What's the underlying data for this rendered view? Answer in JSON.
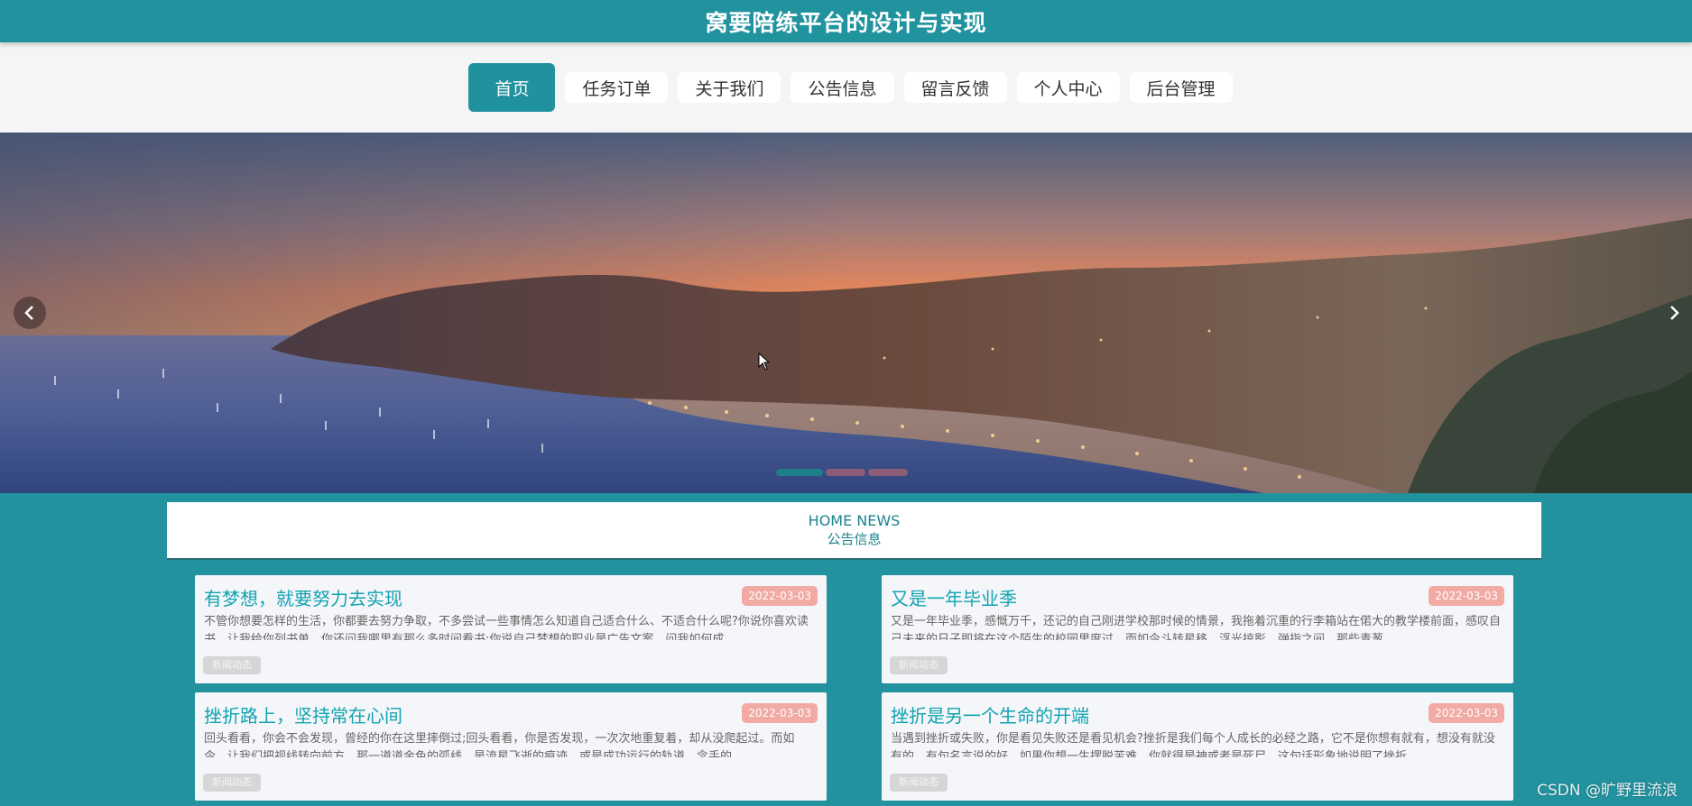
{
  "header": {
    "title": "窝要陪练平台的设计与实现"
  },
  "nav": {
    "items": [
      {
        "label": "首页",
        "active": true
      },
      {
        "label": "任务订单"
      },
      {
        "label": "关于我们"
      },
      {
        "label": "公告信息"
      },
      {
        "label": "留言反馈"
      },
      {
        "label": "个人中心"
      },
      {
        "label": "后台管理"
      }
    ]
  },
  "banner": {
    "image": "harbor-town-sunset-photo",
    "prev_icon": "chevron-left-icon",
    "next_icon": "chevron-right-icon",
    "slides_count": 3,
    "active_slide": 1
  },
  "news_section": {
    "title_en": "HOME NEWS",
    "title_zh": "公告信息"
  },
  "news": [
    {
      "title": "有梦想，就要努力去实现",
      "date": "2022-03-03",
      "excerpt": "不管你想要怎样的生活，你都要去努力争取，不多尝试一些事情怎么知道自己适合什么、不适合什么呢?你说你喜欢读书，让我给你列书单，你还问我哪里有那么多时间看书;你说自己梦想的职业是广告文案，问我如何成",
      "tag": "新闻动态"
    },
    {
      "title": "又是一年毕业季",
      "date": "2022-03-03",
      "excerpt": "又是一年毕业季，感慨万千，还记的自己刚进学校那时候的情景，我拖着沉重的行李箱站在偌大的教学楼前面，感叹自己未来的日子即将在这个陌生的校园里度过，而如今斗转星移，浮光掠影，弹指之间，那些青葱",
      "tag": "新闻动态"
    },
    {
      "title": "挫折路上，坚持常在心间",
      "date": "2022-03-03",
      "excerpt": "回头看看，你会不会发现，曾经的你在这里摔倒过;回头看看，你是否发现，一次次地重复着，却从没爬起过。而如今，让我们把视线转向前方，那一道道金色的弧线，是流星飞逝的痕迹，或是成功运行的轨道，念手的",
      "tag": "新闻动态"
    },
    {
      "title": "挫折是另一个生命的开端",
      "date": "2022-03-03",
      "excerpt": "当遇到挫折或失败，你是看见失败还是看见机会?挫折是我们每个人成长的必经之路，它不是你想有就有，想没有就没有的。有句名言说的好，如果你想一生摆脱苦难，你就得是神或者是死尸，这句话形象地说明了挫折",
      "tag": "新闻动态"
    }
  ],
  "watermark": "CSDN @旷野里流浪",
  "colors": {
    "primary": "#1f929e",
    "title_text": "#12a3b0",
    "date_badge": "#f1aaa4",
    "tag_bg": "#d6d6d6"
  }
}
